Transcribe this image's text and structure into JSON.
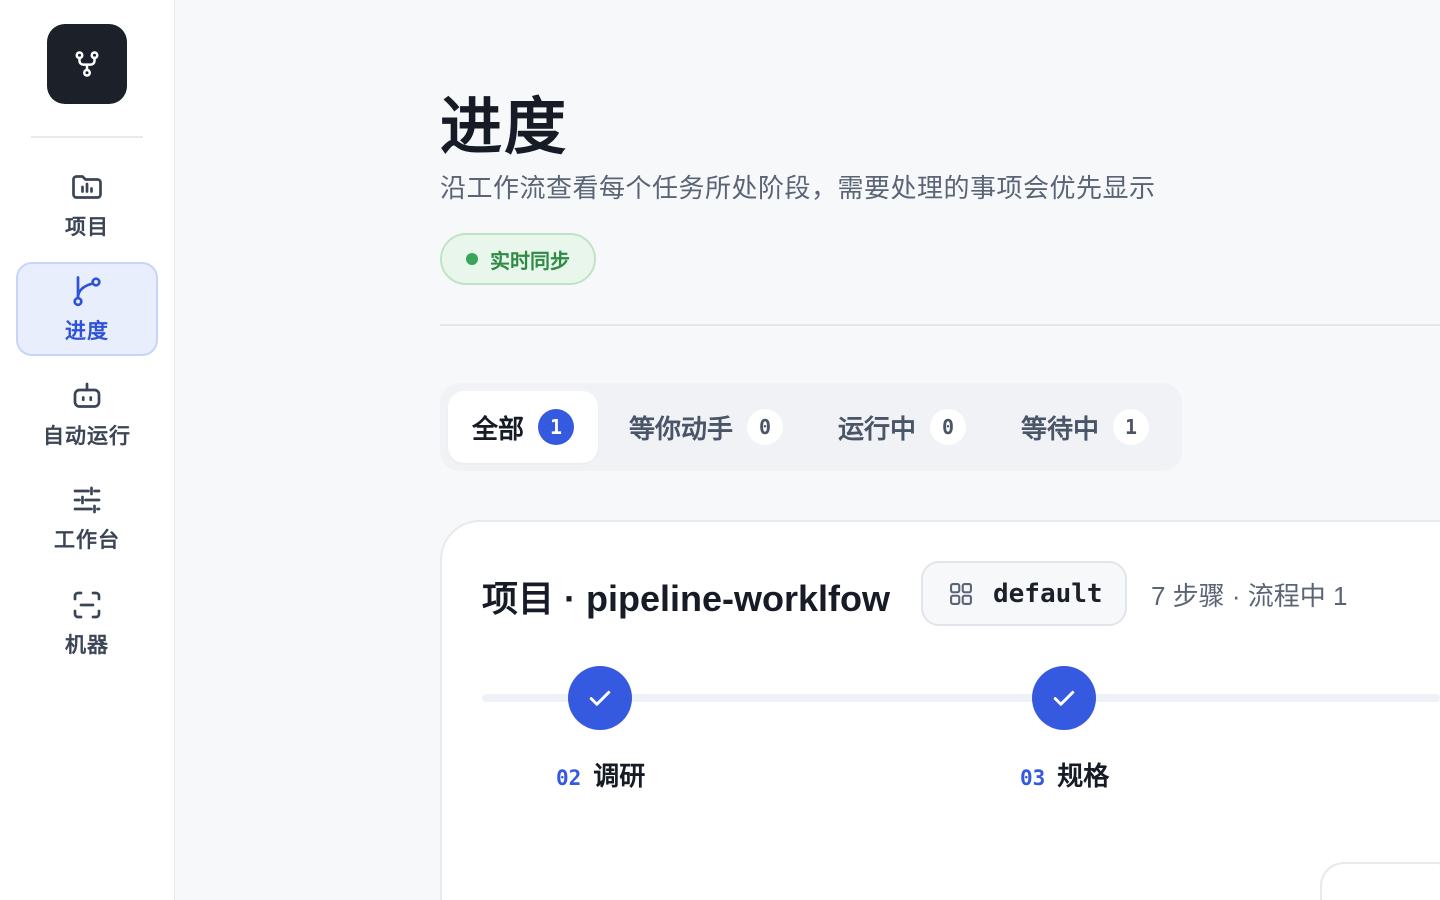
{
  "sidebar": {
    "logo_icon": "workflow-branch-icon",
    "items": [
      {
        "label": "项目",
        "icon": "folder-chart-icon",
        "active": false
      },
      {
        "label": "进度",
        "icon": "git-branch-icon",
        "active": true
      },
      {
        "label": "自动运行",
        "icon": "robot-icon",
        "active": false
      },
      {
        "label": "工作台",
        "icon": "sliders-icon",
        "active": false
      },
      {
        "label": "机器",
        "icon": "scan-frame-icon",
        "active": false
      }
    ]
  },
  "header": {
    "title": "进度",
    "subtitle": "沿工作流查看每个任务所处阶段，需要处理的事项会优先显示",
    "live_badge": "实时同步"
  },
  "tabs": [
    {
      "label": "全部",
      "count": "1",
      "active": true
    },
    {
      "label": "等你动手",
      "count": "0",
      "active": false
    },
    {
      "label": "运行中",
      "count": "0",
      "active": false
    },
    {
      "label": "等待中",
      "count": "1",
      "active": false
    }
  ],
  "project": {
    "title": "项目 · pipeline-worklfow",
    "env_label": "default",
    "env_icon": "grid-icon",
    "step_meta": "7 步骤 · 流程中 1",
    "steps": [
      {
        "num": "02",
        "name": "调研",
        "status": "done",
        "icon": "check-icon"
      },
      {
        "num": "03",
        "name": "规格",
        "status": "done",
        "icon": "check-icon"
      }
    ]
  },
  "colors": {
    "accent": "#3559df",
    "live_green": "#2f8a45",
    "logo_bg": "#1b2029"
  }
}
